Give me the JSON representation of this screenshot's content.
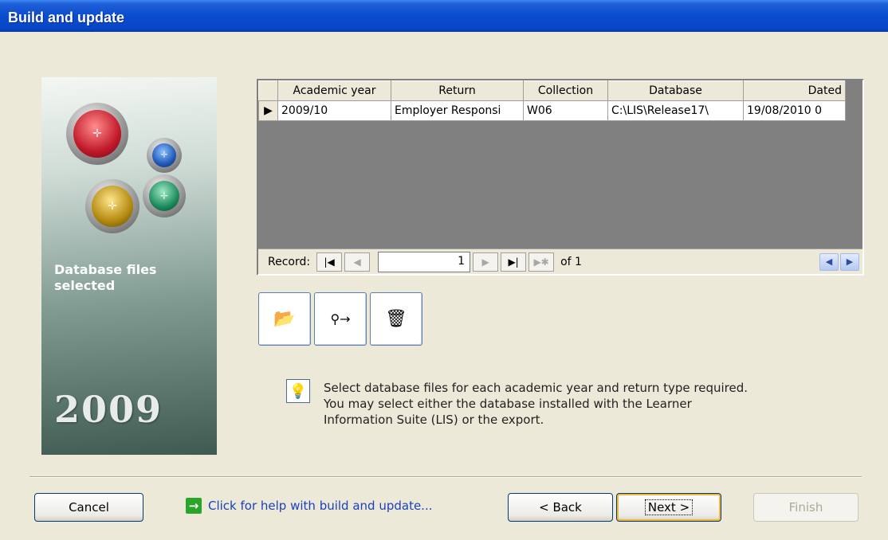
{
  "window": {
    "title": "Build and update"
  },
  "sidebar": {
    "caption": "Database files selected",
    "year": "2009"
  },
  "grid": {
    "columns": [
      "Academic year",
      "Return",
      "Collection",
      "Database",
      "Dated"
    ],
    "rows": [
      [
        "2009/10",
        "Employer Responsi",
        "W06",
        "C:\\LIS\\Release17\\",
        "19/08/2010 0"
      ]
    ]
  },
  "record_nav": {
    "label": "Record:",
    "current": "1",
    "of_label": "of 1"
  },
  "toolbar": {
    "open_icon": "folder-open-icon",
    "find_icon": "binoculars-icon",
    "delete_icon": "trash-icon"
  },
  "info": {
    "text": "Select database files for each academic year and return type required.\nYou may select either the database installed with the Learner\nInformation Suite (LIS) or the export."
  },
  "footer": {
    "cancel_label": "Cancel",
    "help_label": "Click for help with build and update...",
    "back_label": "< Back",
    "next_label": "Next >",
    "finish_label": "Finish"
  }
}
